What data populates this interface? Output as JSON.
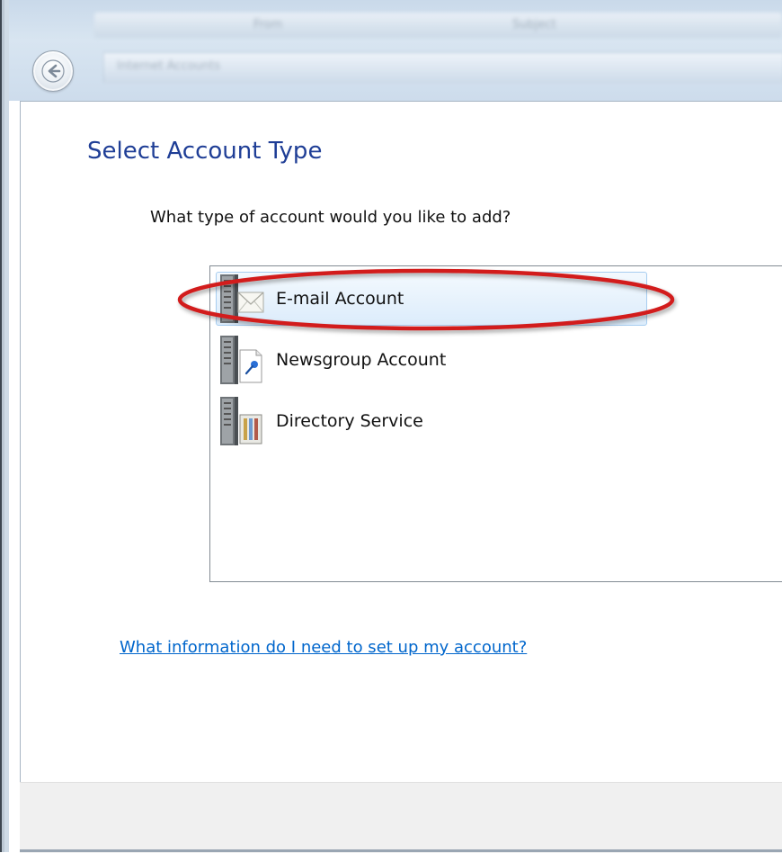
{
  "background_window": {
    "column_from": "From",
    "column_subject": "Subject",
    "ghost_row": "Internet Accounts"
  },
  "navigation": {
    "back_icon": "back-arrow-icon"
  },
  "wizard": {
    "title": "Select Account Type",
    "question": "What type of account would you like to add?",
    "account_types": [
      {
        "label": "E-mail Account",
        "icon": "email-server-icon",
        "selected": true
      },
      {
        "label": "Newsgroup Account",
        "icon": "newsgroup-server-icon",
        "selected": false
      },
      {
        "label": "Directory Service",
        "icon": "directory-server-icon",
        "selected": false
      }
    ],
    "help_link": "What information do I need to set up my account?"
  },
  "annotation": {
    "highlight_color": "#d21f1f",
    "highlighted_item": "E-mail Account"
  },
  "colors": {
    "title": "#1f3e96",
    "link": "#0066cc",
    "selection_fill": "#dcecfb",
    "selection_border": "#a7cdf0"
  }
}
